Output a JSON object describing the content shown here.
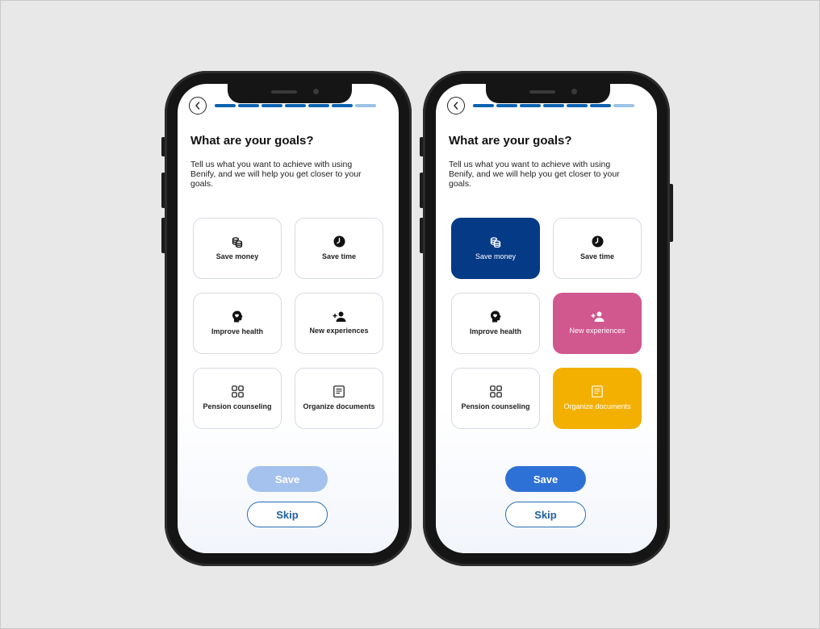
{
  "screens": [
    {
      "title": "What are your goals?",
      "description": "Tell us what you want to achieve with using Benify, and we will help you get closer to your goals.",
      "goals": [
        "Save money",
        "Save time",
        "Improve health",
        "New experiences",
        "Pension counseling",
        "Organize documents"
      ],
      "selected": [
        false,
        false,
        false,
        false,
        false,
        false
      ],
      "save_label": "Save",
      "save_state": "disabled",
      "skip_label": "Skip"
    },
    {
      "title": "What are your goals?",
      "description": "Tell us what you want to achieve with using Benify, and we will help you get closer to your goals.",
      "goals": [
        "Save money",
        "Save time",
        "Improve health",
        "New experiences",
        "Pension counseling",
        "Organize documents"
      ],
      "selected": [
        true,
        false,
        false,
        true,
        false,
        true
      ],
      "save_label": "Save",
      "save_state": "enabled",
      "skip_label": "Skip"
    }
  ],
  "progress": {
    "completed_steps": 6,
    "total_steps": 7
  },
  "icons": [
    "back-chevron-icon",
    "coins-icon",
    "clock-icon",
    "head-heart-icon",
    "add-person-icon",
    "grid-icon",
    "document-icon"
  ],
  "colors": {
    "primary": "#0b63b0",
    "save_money_selected": "#053a86",
    "new_experiences_selected": "#d1578f",
    "organize_documents_selected": "#f3b000",
    "save_disabled": "#a5c2ee",
    "save_enabled": "#2e71d6"
  }
}
